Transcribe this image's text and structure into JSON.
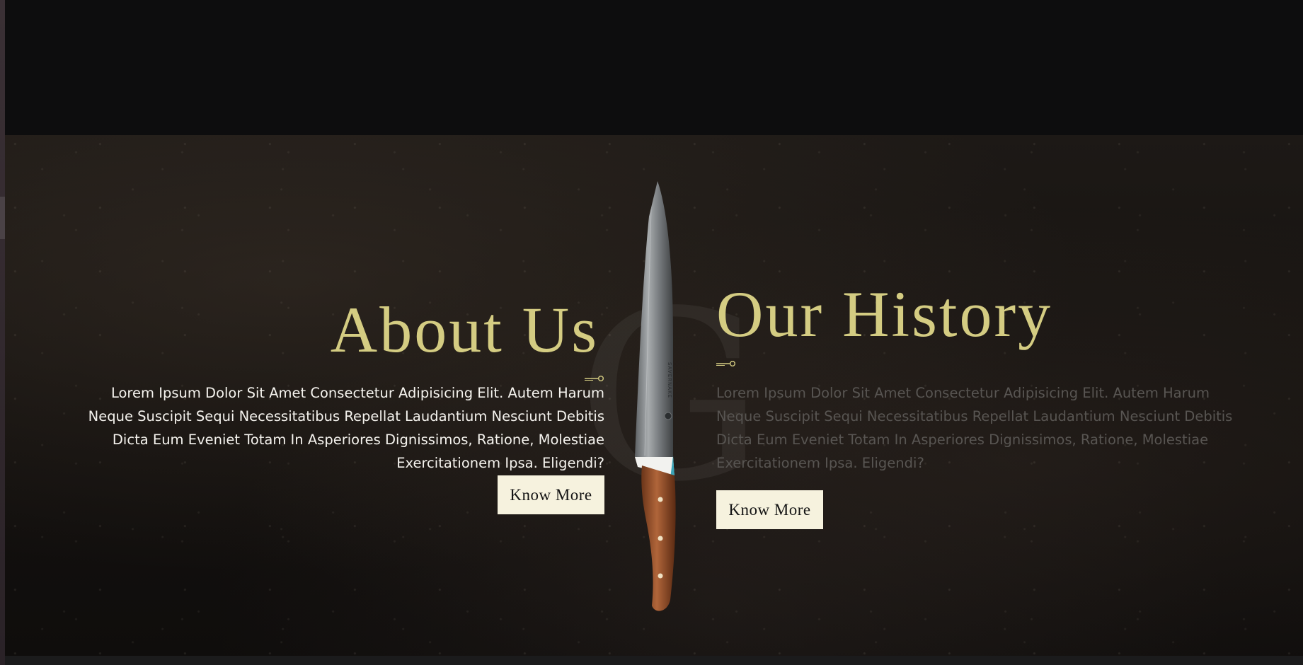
{
  "about": {
    "title": "About Us",
    "text": "Lorem Ipsum Dolor Sit Amet Consectetur Adipisicing Elit. Autem Harum Neque Suscipit Sequi Necessitatibus Repellat Laudantium Nesciunt Debitis Dicta Eum Eveniet Totam In Asperiores Dignissimos, Ratione, Molestiae Exercitationem Ipsa. Eligendi?",
    "button_label": "Know More"
  },
  "history": {
    "title": "Our History",
    "text": "Lorem Ipsum Dolor Sit Amet Consectetur Adipisicing Elit. Autem Harum Neque Suscipit Sequi Necessitatibus Repellat Laudantium Nesciunt Debitis Dicta Eum Eveniet Totam In Asperiores Dignissimos, Ratione, Molestiae Exercitationem Ipsa. Eligendi?",
    "button_label": "Know More"
  },
  "watermark": {
    "letter": "G"
  },
  "knife": {
    "blade_engraving": "SAVERNAKE"
  },
  "icons": {
    "divider": "key-divider-icon",
    "knife": "chef-knife-icon"
  },
  "colors": {
    "accent_gold": "#d4cc82",
    "button_bg": "#f6f2de",
    "page_bg": "#0d0d0e",
    "muted_text": "#585552"
  }
}
